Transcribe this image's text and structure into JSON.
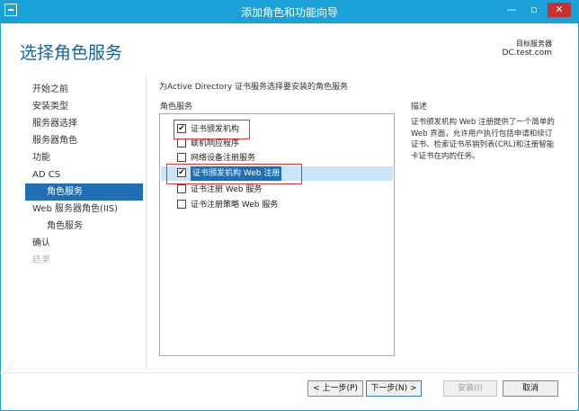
{
  "window": {
    "title": "添加角色和功能向导"
  },
  "header": {
    "page_title": "选择角色服务",
    "server_caption": "目标服务器",
    "server_name": "DC.test.com"
  },
  "nav": {
    "items": [
      {
        "label": "开始之前",
        "state": "normal"
      },
      {
        "label": "安装类型",
        "state": "normal"
      },
      {
        "label": "服务器选择",
        "state": "normal"
      },
      {
        "label": "服务器角色",
        "state": "normal"
      },
      {
        "label": "功能",
        "state": "normal"
      },
      {
        "label": "AD CS",
        "state": "normal"
      },
      {
        "label": "角色服务",
        "state": "active"
      },
      {
        "label": "Web 服务器角色(IIS)",
        "state": "normal"
      },
      {
        "label": "角色服务",
        "state": "sub"
      },
      {
        "label": "确认",
        "state": "normal"
      },
      {
        "label": "结果",
        "state": "disabled"
      }
    ]
  },
  "main": {
    "intro": "为Active Directory 证书服务选择要安装的角色服务",
    "list_heading": "角色服务",
    "role_services": [
      {
        "label": "证书颁发机构",
        "checked": true,
        "selected": false
      },
      {
        "label": "联机响应程序",
        "checked": false,
        "selected": false
      },
      {
        "label": "网络设备注册服务",
        "checked": false,
        "selected": false
      },
      {
        "label": "证书颁发机构 Web 注册",
        "checked": true,
        "selected": true
      },
      {
        "label": "证书注册 Web 服务",
        "checked": false,
        "selected": false
      },
      {
        "label": "证书注册策略 Web 服务",
        "checked": false,
        "selected": false
      }
    ],
    "description_heading": "描述",
    "description": "证书颁发机构 Web 注册提供了一个简单的 Web 界面，允许用户执行包括申请和续订证书、检索证书吊销列表(CRL)和注册智能卡证书在内的任务。"
  },
  "footer": {
    "prev": "< 上一步(P)",
    "next": "下一步(N) >",
    "install": "安装(I)",
    "cancel": "取消"
  },
  "colors": {
    "titlebar": "#1aa1d8",
    "page_title": "#1464a5",
    "nav_active": "#1f6fb2",
    "list_selected": "#cbe5f8",
    "annotation_box": "#dd3333"
  },
  "icons": {
    "checkbox_checked": "✔"
  }
}
